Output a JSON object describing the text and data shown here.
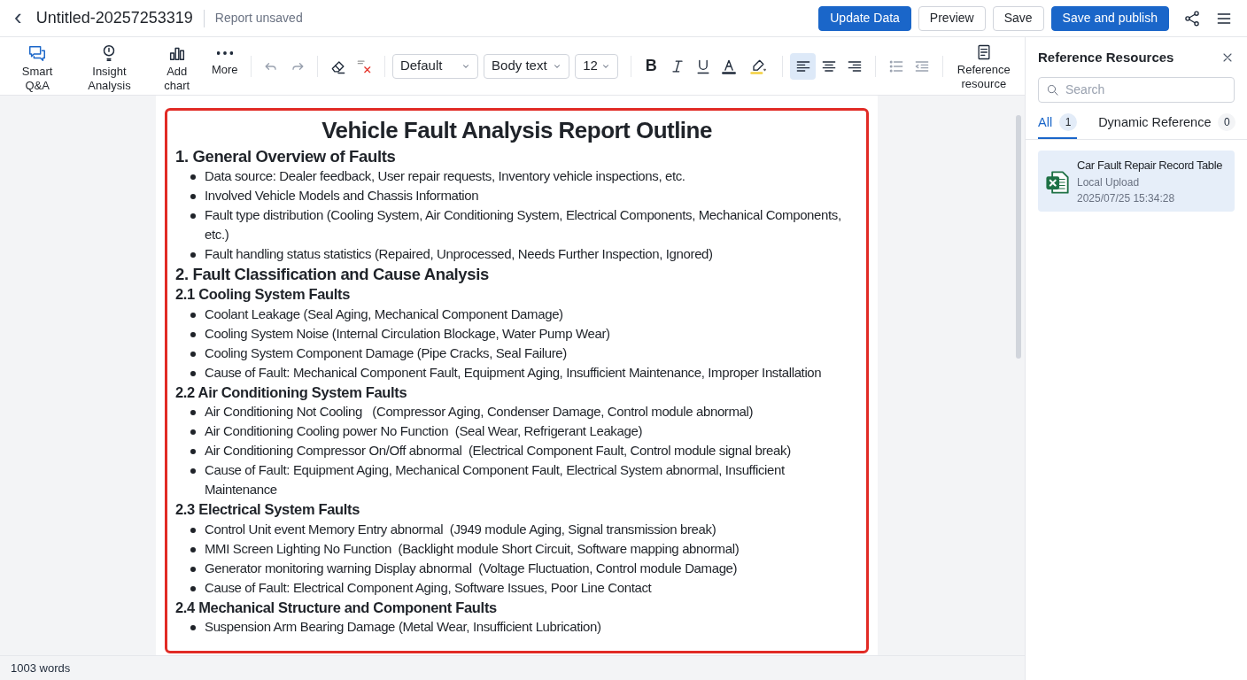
{
  "header": {
    "back_icon": "‹",
    "title": "Untitled-20257253319",
    "status": "Report unsaved",
    "buttons": [
      {
        "label": "Update Data",
        "kind": "primary"
      },
      {
        "label": "Preview",
        "kind": "outline"
      },
      {
        "label": "Save",
        "kind": "outline"
      },
      {
        "label": "Save and publish",
        "kind": "primary"
      }
    ]
  },
  "toolbar": {
    "tools": [
      {
        "label": "Smart Q&A",
        "kind": "chat"
      },
      {
        "label": "Insight Analysis",
        "kind": "bulb"
      },
      {
        "label": "Add chart",
        "kind": "chart"
      },
      {
        "label": "More",
        "kind": "more"
      }
    ],
    "bold_label": "B",
    "font": "Default",
    "style": "Body text",
    "size": "12",
    "alignments": [
      {
        "kind": "left",
        "selected": true
      },
      {
        "kind": "center",
        "selected": false
      },
      {
        "kind": "right",
        "selected": false
      }
    ],
    "reference": "Reference resource"
  },
  "document": {
    "title": "Vehicle Fault Analysis Report Outline",
    "blocks": [
      {
        "kind": "heading",
        "text": "1. General Overview of Faults"
      },
      {
        "kind": "bullet",
        "text": "Data source: Dealer feedback, User repair requests, Inventory vehicle inspections, etc."
      },
      {
        "kind": "bullet",
        "text": "Involved Vehicle Models and Chassis Information"
      },
      {
        "kind": "bullet",
        "text": "Fault type distribution (Cooling System, Air Conditioning System, Electrical Components, Mechanical Components, etc.)"
      },
      {
        "kind": "bullet",
        "text": "Fault handling status statistics (Repaired, Unprocessed, Needs Further Inspection, Ignored)"
      },
      {
        "kind": "heading",
        "text": "2. Fault Classification and Cause Analysis"
      },
      {
        "kind": "subheading",
        "text": "2.1 Cooling System Faults"
      },
      {
        "kind": "bullet",
        "text": "Coolant Leakage (Seal Aging, Mechanical Component Damage)"
      },
      {
        "kind": "bullet",
        "text": "Cooling System Noise (Internal Circulation Blockage, Water Pump Wear)"
      },
      {
        "kind": "bullet",
        "text": "Cooling System Component Damage (Pipe Cracks, Seal Failure)"
      },
      {
        "kind": "bullet",
        "text": "Cause of Fault: Mechanical Component Fault, Equipment Aging, Insufficient Maintenance, Improper Installation"
      },
      {
        "kind": "subheading",
        "text": "2.2 Air Conditioning System Faults"
      },
      {
        "kind": "bullet",
        "text": "Air Conditioning Not Cooling   (Compressor Aging, Condenser Damage, Control module abnormal)"
      },
      {
        "kind": "bullet",
        "text": "Air Conditioning Cooling power No Function  (Seal Wear, Refrigerant Leakage)"
      },
      {
        "kind": "bullet",
        "text": "Air Conditioning Compressor On/Off abnormal  (Electrical Component Fault, Control module signal break)"
      },
      {
        "kind": "bullet",
        "text": "Cause of Fault: Equipment Aging, Mechanical Component Fault, Electrical System abnormal, Insufficient Maintenance"
      },
      {
        "kind": "subheading",
        "text": "2.3 Electrical System Faults"
      },
      {
        "kind": "bullet",
        "text": "Control Unit event Memory Entry abnormal  (J949 module Aging, Signal transmission break)"
      },
      {
        "kind": "bullet",
        "text": "MMI Screen Lighting No Function  (Backlight module Short Circuit, Software mapping abnormal)"
      },
      {
        "kind": "bullet",
        "text": "Generator monitoring warning Display abnormal  (Voltage Fluctuation, Control module Damage)"
      },
      {
        "kind": "bullet",
        "text": "Cause of Fault: Electrical Component Aging, Software Issues, Poor Line Contact"
      },
      {
        "kind": "subheading",
        "text": "2.4 Mechanical Structure and Component Faults"
      },
      {
        "kind": "bullet",
        "text": "Suspension Arm Bearing Damage (Metal Wear, Insufficient Lubrication)"
      }
    ]
  },
  "status_bar": {
    "word_count": "1003 words"
  },
  "panel": {
    "title": "Reference Resources",
    "search": {
      "placeholder": "Search"
    },
    "tabs": [
      {
        "label": "All",
        "count": "1",
        "selected": true
      },
      {
        "label": "Dynamic Reference",
        "count": "0",
        "selected": false
      }
    ],
    "items": [
      {
        "name": "Car Fault Repair Record Table",
        "source": "Local Upload",
        "time": "2025/07/25 15:34:28"
      }
    ]
  }
}
